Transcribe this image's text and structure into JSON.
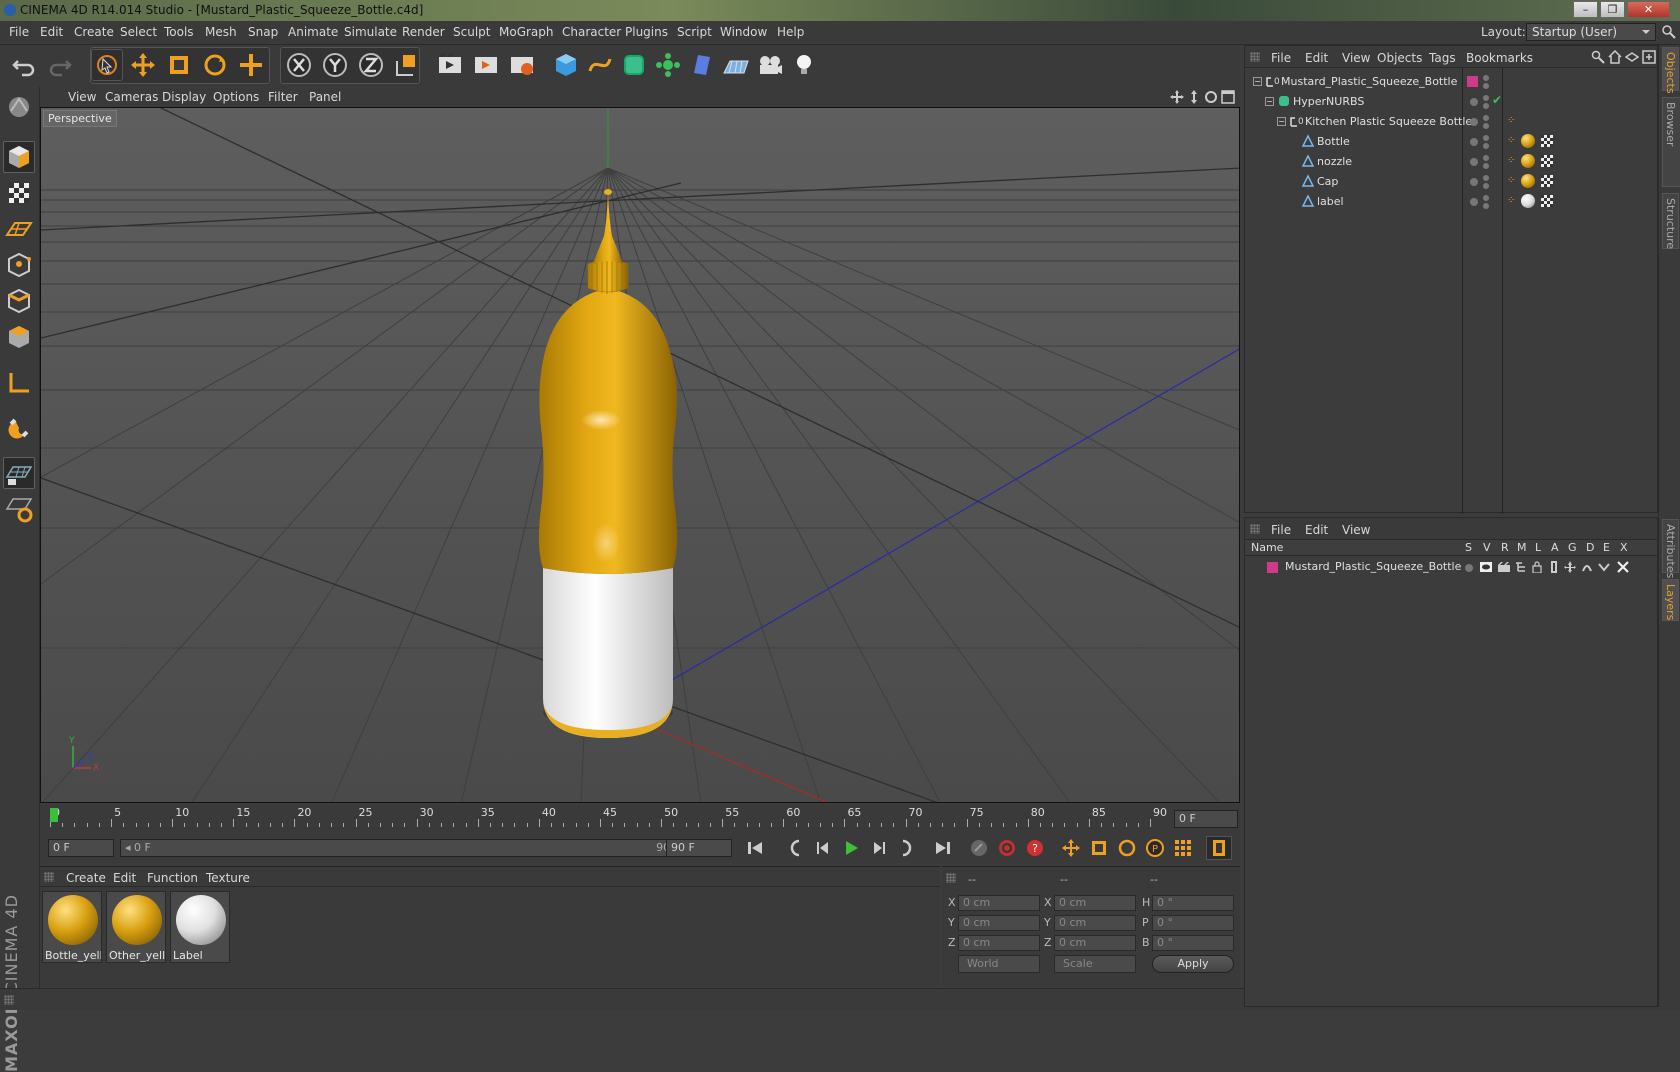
{
  "window": {
    "title": "CINEMA 4D R14.014 Studio - [Mustard_Plastic_Squeeze_Bottle.c4d]",
    "btn_min": "–",
    "btn_max": "❐",
    "btn_close": "✕"
  },
  "menubar": {
    "items": [
      "File",
      "Edit",
      "Create",
      "Select",
      "Tools",
      "Mesh",
      "Snap",
      "Animate",
      "Simulate",
      "Render",
      "Sculpt",
      "MoGraph",
      "Character",
      "Plugins",
      "Script",
      "Window",
      "Help"
    ],
    "layout_label": "Layout:",
    "layout_value": "Startup (User)"
  },
  "viewport": {
    "menu": [
      "View",
      "Cameras",
      "Display",
      "Options",
      "Filter",
      "Panel"
    ],
    "camera_label": "Perspective",
    "axis_x": "X",
    "axis_y": "Y",
    "axis_z": "Z"
  },
  "timeline": {
    "ticks": [
      "0",
      "5",
      "10",
      "15",
      "20",
      "25",
      "30",
      "35",
      "40",
      "45",
      "50",
      "55",
      "60",
      "65",
      "70",
      "75",
      "80",
      "85",
      "90"
    ],
    "current_frame": "0 F",
    "start_field": "0 F",
    "range_start": "0 F",
    "range_end": "90 F",
    "end_field": "90 F"
  },
  "materials": {
    "menu": [
      "Create",
      "Edit",
      "Function",
      "Texture"
    ],
    "items": [
      {
        "name": "Bottle_yello",
        "color": "#d8a010"
      },
      {
        "name": "Other_yello",
        "color": "#d8a010"
      },
      {
        "name": "Label",
        "color": "#f0f0f0"
      }
    ],
    "brand_top": "MAXON",
    "brand_bottom": "CINEMA 4D"
  },
  "coordinates": {
    "headers": [
      "--",
      "--",
      "--"
    ],
    "rows": [
      {
        "a": "X",
        "a_val": "0 cm",
        "b": "X",
        "b_val": "0 cm",
        "c": "H",
        "c_val": "0 °"
      },
      {
        "a": "Y",
        "a_val": "0 cm",
        "b": "Y",
        "b_val": "0 cm",
        "c": "P",
        "c_val": "0 °"
      },
      {
        "a": "Z",
        "a_val": "0 cm",
        "b": "Z",
        "b_val": "0 cm",
        "c": "B",
        "c_val": "0 °"
      }
    ],
    "space": "World",
    "mode": "Scale",
    "apply": "Apply"
  },
  "object_manager": {
    "menu": [
      "File",
      "Edit",
      "View",
      "Objects",
      "Tags",
      "Bookmarks"
    ],
    "objects": [
      {
        "name": "Mustard_Plastic_Squeeze_Bottle",
        "icon": "null-icon"
      },
      {
        "name": "HyperNURBS",
        "icon": "hypernurbs-icon"
      },
      {
        "name": "Kitchen Plastic Squeeze Bottle",
        "icon": "null-icon"
      },
      {
        "name": "Bottle",
        "icon": "polygon-icon"
      },
      {
        "name": "nozzle",
        "icon": "polygon-icon"
      },
      {
        "name": "Cap",
        "icon": "polygon-icon"
      },
      {
        "name": "label",
        "icon": "polygon-icon"
      }
    ]
  },
  "layer_manager": {
    "menu": [
      "File",
      "Edit",
      "View"
    ],
    "columns": [
      "Name",
      "S",
      "V",
      "R",
      "M",
      "L",
      "A",
      "G",
      "D",
      "E",
      "X"
    ],
    "layers": [
      {
        "name": "Mustard_Plastic_Squeeze_Bottle",
        "color": "#d03a8a"
      }
    ]
  },
  "right_tabs": [
    "Objects",
    "Content Browser",
    "Structure",
    "Attributes",
    "Layers"
  ],
  "colors": {
    "accent": "#e8a030",
    "mustard": "#d8a010",
    "layer": "#d03a8a"
  }
}
